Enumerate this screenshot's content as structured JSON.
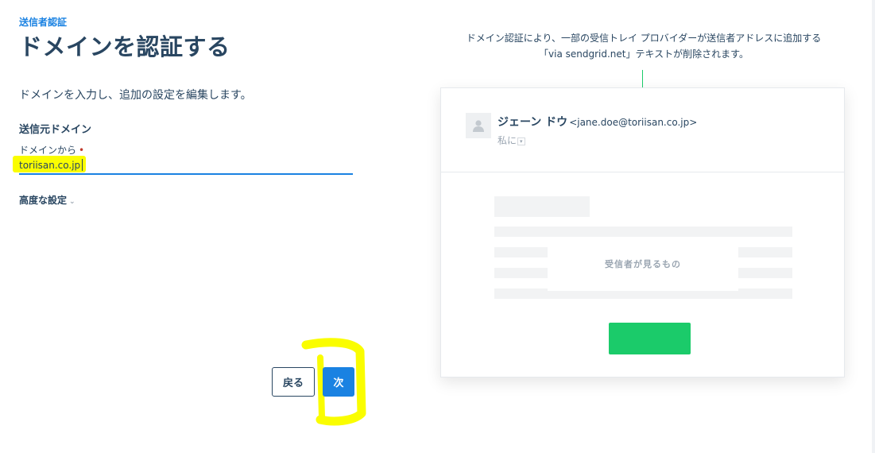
{
  "breadcrumb": "送信者認証",
  "page_title": "ドメインを認証する",
  "description": "ドメインを入力し、追加の設定を編集します。",
  "section_title": "送信元ドメイン",
  "field": {
    "label": "ドメインから",
    "required_mark": "•",
    "value": "toriisan.co.jp"
  },
  "advanced_settings": "高度な設定",
  "buttons": {
    "back": "戻る",
    "next": "次"
  },
  "callout": {
    "line1": "ドメイン認証により、一部の受信トレイ プロバイダーが送信者アドレスに追加する",
    "line2": "「via sendgrid.net」テキストが削除されます。"
  },
  "email_preview": {
    "sender_name": "ジェーン ドウ",
    "sender_email": "<jane.doe@toriisan.co.jp>",
    "to": "私に",
    "preview_label": "受信者が見るもの"
  },
  "colors": {
    "accent": "#1a82e2",
    "title": "#294661",
    "cta_green": "#1bcb6a",
    "highlighter": "#fafd00"
  },
  "icons": [
    "user-avatar-icon",
    "chevron-down-icon",
    "caret-down-icon"
  ]
}
